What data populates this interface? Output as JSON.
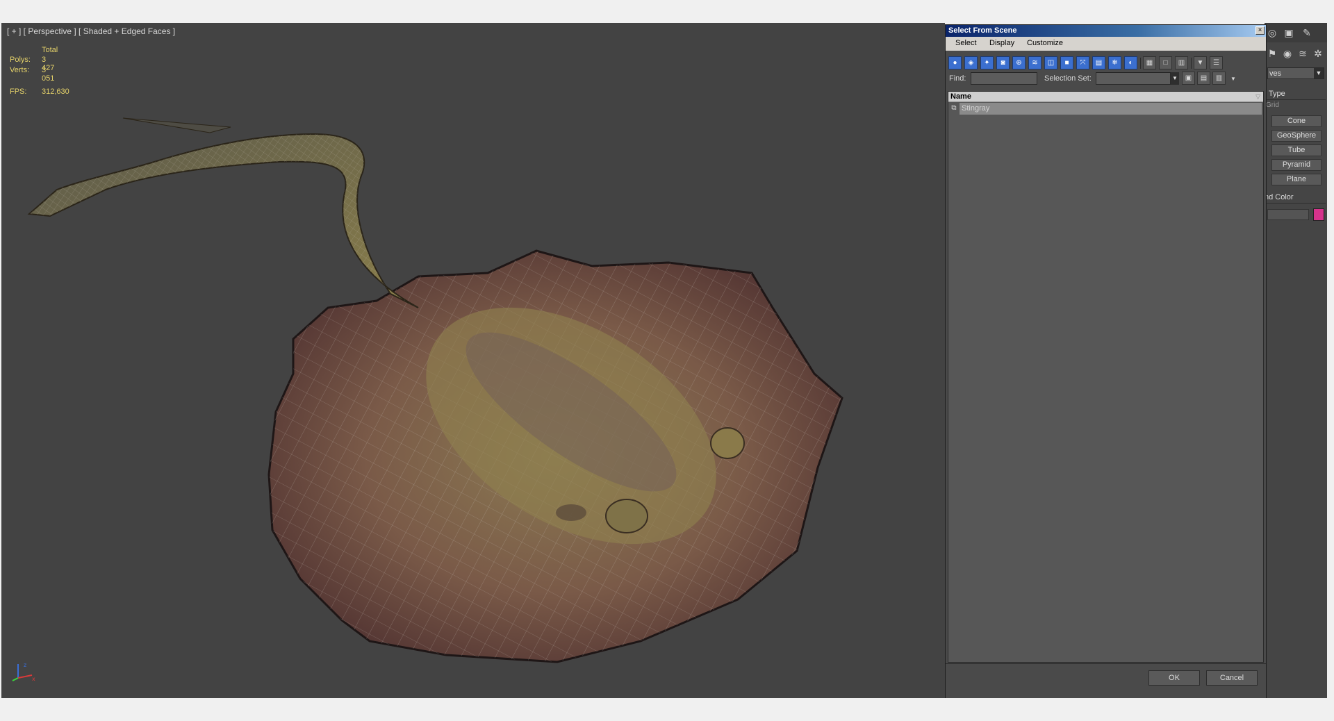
{
  "viewport": {
    "label": "[ + ] [ Perspective ] [ Shaded + Edged Faces ]",
    "stats": {
      "total_label": "Total",
      "polys_label": "Polys:",
      "polys_value": "3 427",
      "verts_label": "Verts:",
      "verts_value": "3 051",
      "fps_label": "FPS:",
      "fps_value": "312,630"
    },
    "axis": {
      "x": "x",
      "y": "y",
      "z": "z"
    }
  },
  "dialog": {
    "title": "Select From Scene",
    "close": "×",
    "menu": [
      "Select",
      "Display",
      "Customize"
    ],
    "find_label": "Find:",
    "find_value": "",
    "selection_set_label": "Selection Set:",
    "selection_set_value": "",
    "column_header": "Name",
    "rows": [
      {
        "name": "Stingray"
      }
    ],
    "ok_label": "OK",
    "cancel_label": "Cancel"
  },
  "command_panel": {
    "dropdown_value": "ves",
    "object_type_label": "t Type",
    "grid_label": "Grid",
    "buttons": [
      "Cone",
      "GeoSphere",
      "Tube",
      "Pyramid",
      "Plane"
    ],
    "name_color_label": "nd Color",
    "swatch_color": "#d6338c"
  }
}
